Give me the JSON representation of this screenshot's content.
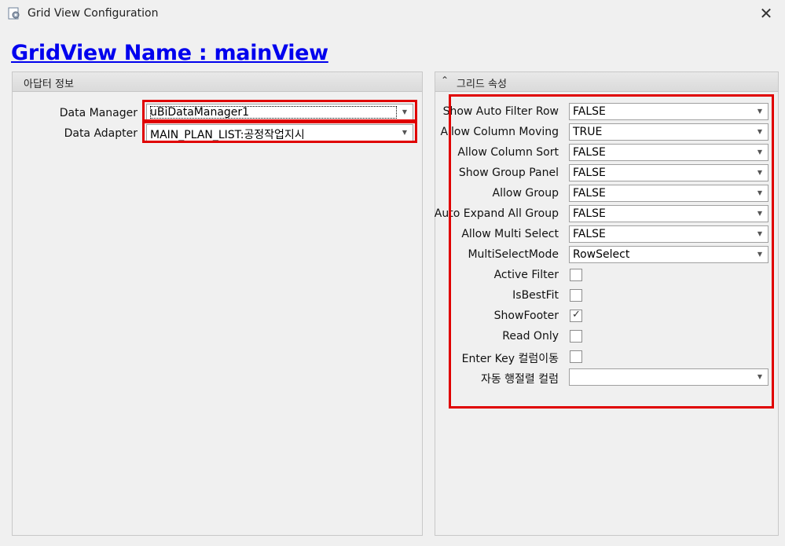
{
  "window": {
    "title": "Grid View Configuration"
  },
  "gridview_name": "GridView Name : mainView",
  "left_panel": {
    "title": "아답터 정보",
    "fields": [
      {
        "label": "Data Manager",
        "value": "uBiDataManager1"
      },
      {
        "label": "Data Adapter",
        "value": "MAIN_PLAN_LIST:공정작업지시"
      }
    ]
  },
  "right_panel": {
    "title": "그리드 속성",
    "combos": [
      {
        "label": "Show Auto Filter Row",
        "value": "FALSE"
      },
      {
        "label": "Allow Column Moving",
        "value": "TRUE"
      },
      {
        "label": "Allow Column Sort",
        "value": "FALSE"
      },
      {
        "label": "Show Group Panel",
        "value": "FALSE"
      },
      {
        "label": "Allow Group",
        "value": "FALSE"
      },
      {
        "label": "Auto Expand All Group",
        "value": "FALSE"
      },
      {
        "label": "Allow Multi Select",
        "value": "FALSE"
      },
      {
        "label": "MultiSelectMode",
        "value": "RowSelect"
      }
    ],
    "checks": [
      {
        "label": "Active Filter",
        "checked": false
      },
      {
        "label": "IsBestFit",
        "checked": false
      },
      {
        "label": "ShowFooter",
        "checked": true,
        "mark": "✓"
      },
      {
        "label": "Read Only",
        "checked": false
      },
      {
        "label": "Enter Key 컬럼이동",
        "checked": false
      }
    ],
    "last_combo": {
      "label": "자동 행절렬 컬럼",
      "value": ""
    }
  },
  "colors": {
    "highlight": "#e00000",
    "link": "#0000ee"
  }
}
